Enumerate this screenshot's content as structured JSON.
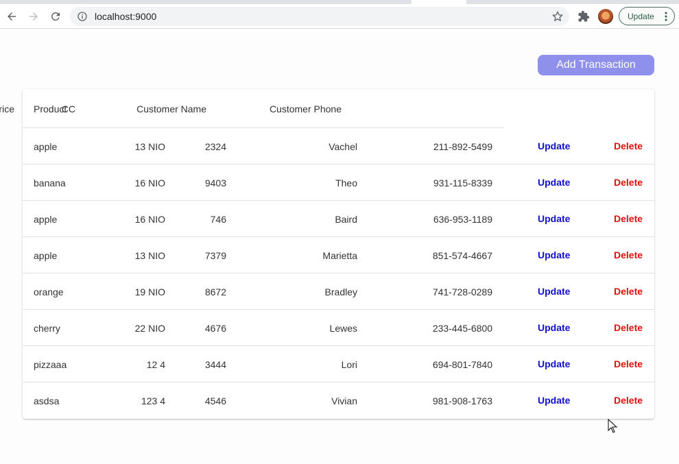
{
  "browser": {
    "url": "localhost:9000",
    "update_label": "Update"
  },
  "page": {
    "add_button_label": "Add Transaction"
  },
  "table": {
    "headers": {
      "product": "Product",
      "price": "Price",
      "cc": "CC",
      "customer_name": "Customer Name",
      "customer_phone": "Customer Phone"
    },
    "update_label": "Update",
    "delete_label": "Delete",
    "rows": [
      {
        "product": "apple",
        "price": "13 NIO",
        "cc": "2324",
        "name": "Vachel",
        "phone": "211-892-5499"
      },
      {
        "product": "banana",
        "price": "16 NIO",
        "cc": "9403",
        "name": "Theo",
        "phone": "931-115-8339"
      },
      {
        "product": "apple",
        "price": "16 NIO",
        "cc": "746",
        "name": "Baird",
        "phone": "636-953-1189"
      },
      {
        "product": "apple",
        "price": "13 NIO",
        "cc": "7379",
        "name": "Marietta",
        "phone": "851-574-4667"
      },
      {
        "product": "orange",
        "price": "19 NIO",
        "cc": "8672",
        "name": "Bradley",
        "phone": "741-728-0289"
      },
      {
        "product": "cherry",
        "price": "22 NIO",
        "cc": "4676",
        "name": "Lewes",
        "phone": "233-445-6800"
      },
      {
        "product": "pizzaaa",
        "price": "12 4",
        "cc": "3444",
        "name": "Lori",
        "phone": "694-801-7840"
      },
      {
        "product": "asdsa",
        "price": "123 4",
        "cc": "4546",
        "name": "Vivian",
        "phone": "981-908-1763"
      }
    ]
  },
  "colors": {
    "accent": "#8f8fec",
    "update_action": "#1010c8",
    "delete_action": "#e01010"
  }
}
